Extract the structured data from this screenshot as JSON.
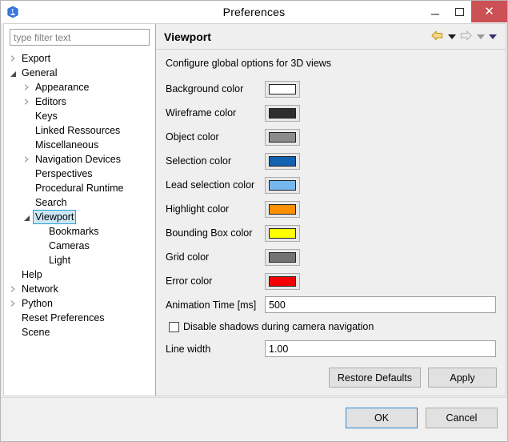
{
  "window": {
    "title": "Preferences",
    "app_icon": "app-logo-icon",
    "controls": {
      "minimize": "minimize-icon",
      "maximize": "maximize-icon",
      "close": "✕"
    }
  },
  "tree": {
    "filter": {
      "value": "",
      "placeholder": "type filter text"
    },
    "items": [
      {
        "label": "Export",
        "depth": 0,
        "twisty": "collapsed",
        "selected": false
      },
      {
        "label": "General",
        "depth": 0,
        "twisty": "expanded",
        "selected": false
      },
      {
        "label": "Appearance",
        "depth": 1,
        "twisty": "collapsed",
        "selected": false
      },
      {
        "label": "Editors",
        "depth": 1,
        "twisty": "collapsed",
        "selected": false
      },
      {
        "label": "Keys",
        "depth": 1,
        "twisty": "none",
        "selected": false
      },
      {
        "label": "Linked Ressources",
        "depth": 1,
        "twisty": "none",
        "selected": false
      },
      {
        "label": "Miscellaneous",
        "depth": 1,
        "twisty": "none",
        "selected": false
      },
      {
        "label": "Navigation Devices",
        "depth": 1,
        "twisty": "collapsed",
        "selected": false
      },
      {
        "label": "Perspectives",
        "depth": 1,
        "twisty": "none",
        "selected": false
      },
      {
        "label": "Procedural Runtime",
        "depth": 1,
        "twisty": "none",
        "selected": false
      },
      {
        "label": "Search",
        "depth": 1,
        "twisty": "none",
        "selected": false
      },
      {
        "label": "Viewport",
        "depth": 1,
        "twisty": "expanded",
        "selected": true
      },
      {
        "label": "Bookmarks",
        "depth": 2,
        "twisty": "none",
        "selected": false
      },
      {
        "label": "Cameras",
        "depth": 2,
        "twisty": "none",
        "selected": false
      },
      {
        "label": "Light",
        "depth": 2,
        "twisty": "none",
        "selected": false
      },
      {
        "label": "Help",
        "depth": 0,
        "twisty": "none",
        "selected": false
      },
      {
        "label": "Network",
        "depth": 0,
        "twisty": "collapsed",
        "selected": false
      },
      {
        "label": "Python",
        "depth": 0,
        "twisty": "collapsed",
        "selected": false
      },
      {
        "label": "Reset Preferences",
        "depth": 0,
        "twisty": "none",
        "selected": false
      },
      {
        "label": "Scene",
        "depth": 0,
        "twisty": "none",
        "selected": false
      }
    ]
  },
  "content": {
    "title": "Viewport",
    "description": "Configure global options for 3D views",
    "nav": {
      "back_icon": "back-arrow-icon",
      "back_menu_icon": "chevron-down-icon",
      "forward_icon": "forward-arrow-icon",
      "forward_menu_icon": "chevron-down-icon",
      "history_menu_icon": "chevron-down-icon",
      "back_color": "#e8b33c",
      "forward_color": "#cfcfcf"
    },
    "color_rows": [
      {
        "label": "Background color",
        "color": "#ffffff"
      },
      {
        "label": "Wireframe color",
        "color": "#2e2e2e"
      },
      {
        "label": "Object color",
        "color": "#8c8c8c"
      },
      {
        "label": "Selection color",
        "color": "#1362b0"
      },
      {
        "label": "Lead selection color",
        "color": "#73b6f0"
      },
      {
        "label": "Highlight color",
        "color": "#ff9000"
      },
      {
        "label": "Bounding Box color",
        "color": "#ffff00"
      },
      {
        "label": "Grid color",
        "color": "#737373"
      },
      {
        "label": "Error color",
        "color": "#f40000"
      }
    ],
    "animation_time": {
      "label": "Animation Time [ms]",
      "value": "500"
    },
    "disable_shadows": {
      "label": "Disable shadows during camera navigation",
      "checked": false
    },
    "line_width": {
      "label": "Line width",
      "value": "1.00"
    },
    "restore_defaults_label": "Restore Defaults",
    "apply_label": "Apply"
  },
  "footer": {
    "ok_label": "OK",
    "cancel_label": "Cancel"
  }
}
